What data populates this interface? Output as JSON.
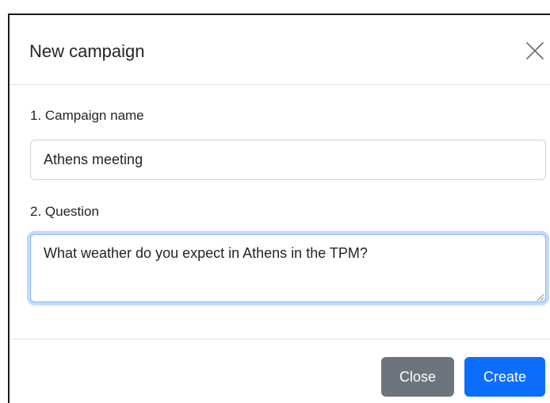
{
  "modal": {
    "title": "New campaign"
  },
  "form": {
    "campaign_name": {
      "label": "1. Campaign name",
      "value": "Athens meeting"
    },
    "question": {
      "label": "2. Question",
      "value": "What weather do you expect in Athens in the TPM?"
    }
  },
  "footer": {
    "close_label": "Close",
    "create_label": "Create"
  },
  "colors": {
    "primary": "#0d6efd",
    "secondary": "#6c757d",
    "focus_border": "#86b7fe",
    "divider": "#dee2e6"
  },
  "icons": {
    "close": "close-icon",
    "resize": "resize-grip-icon"
  }
}
